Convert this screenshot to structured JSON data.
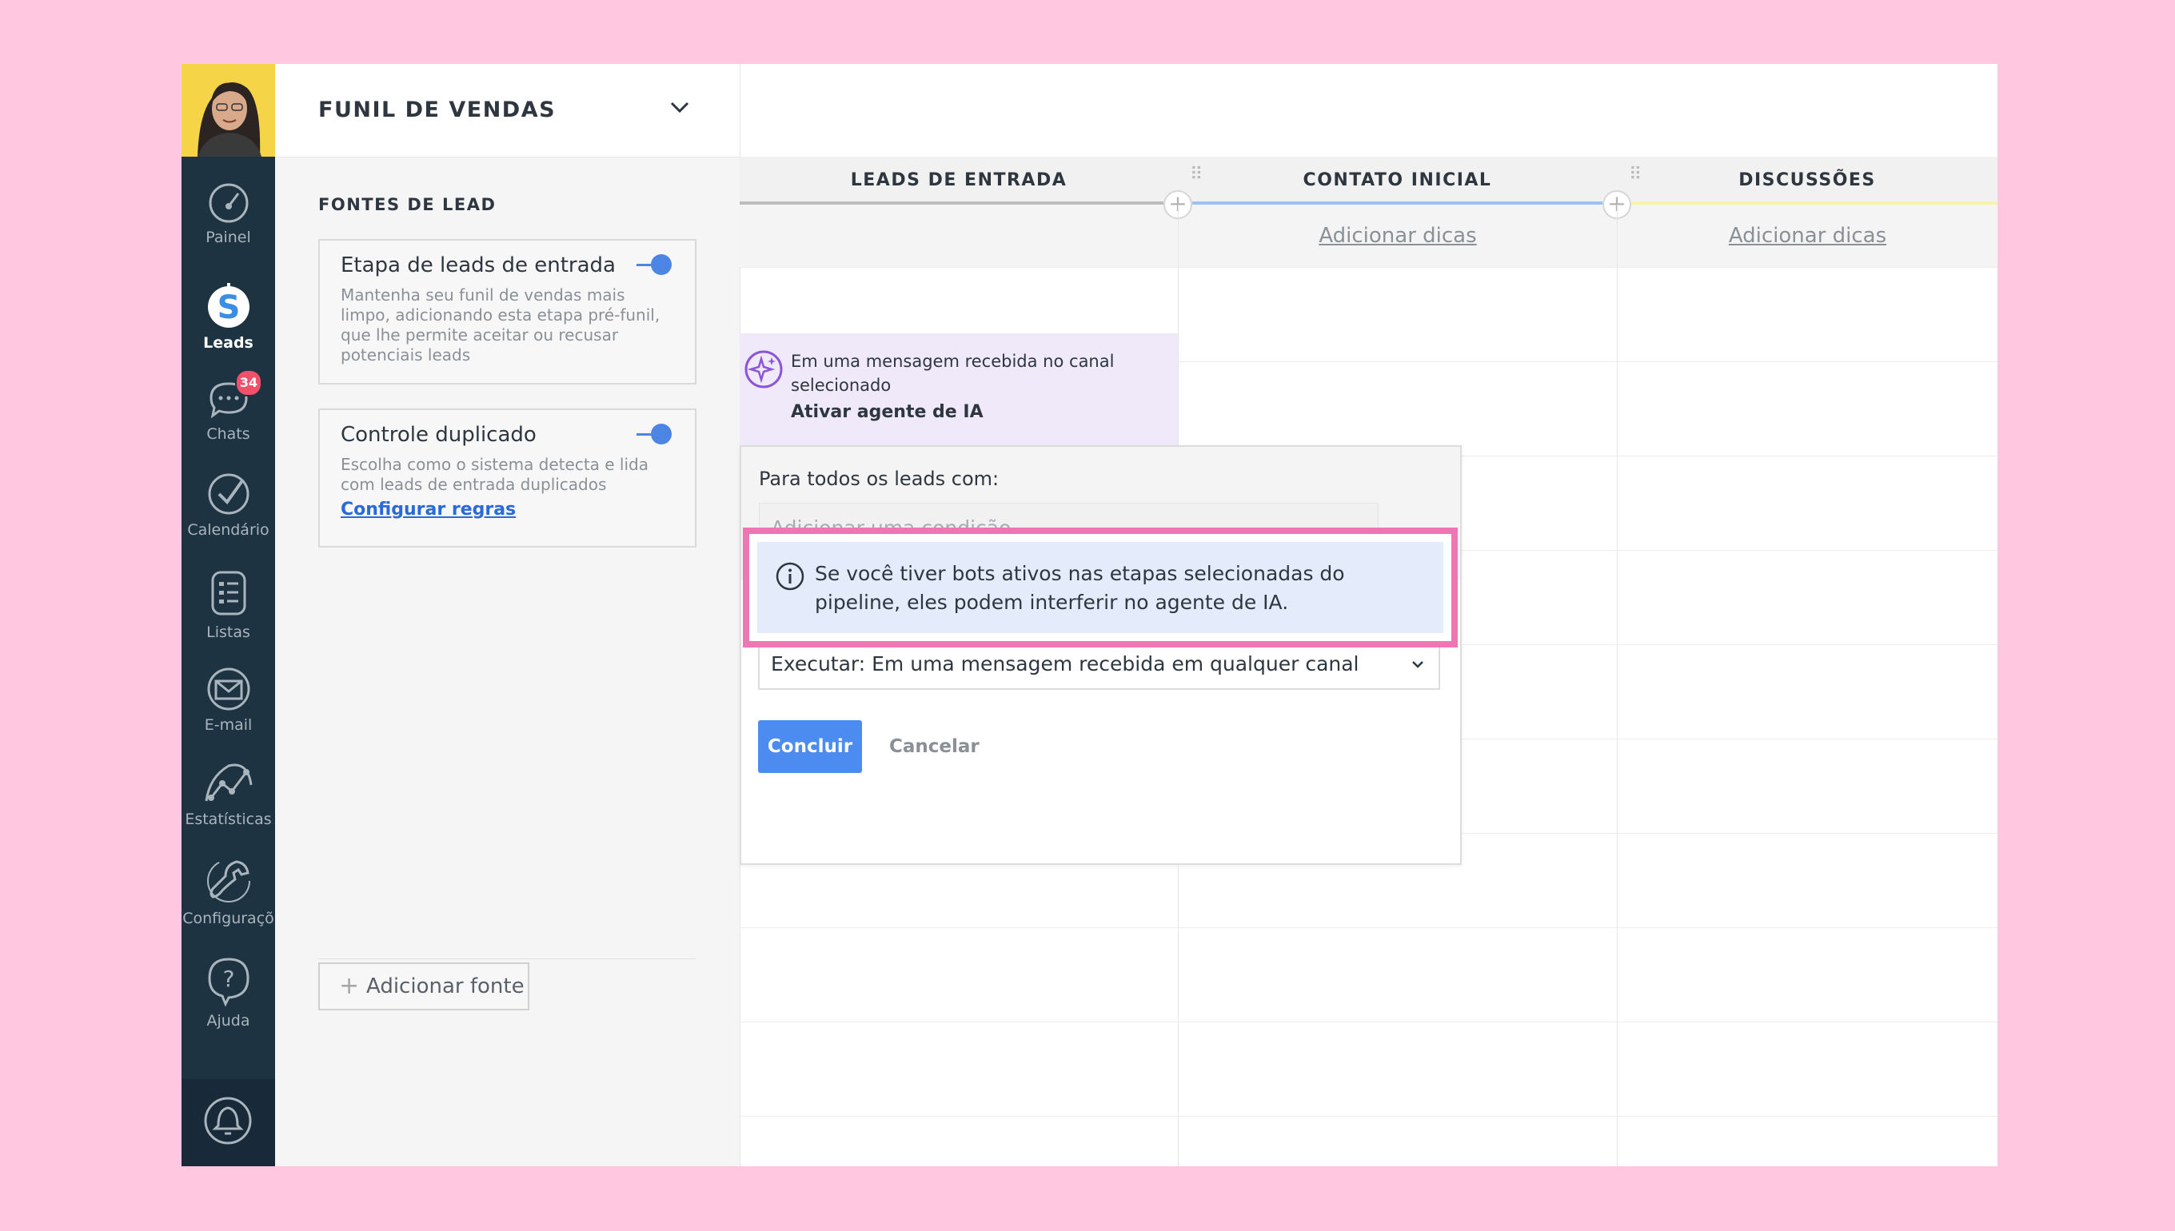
{
  "nav": {
    "items": [
      {
        "label": "Painel",
        "icon": "speedometer-icon"
      },
      {
        "label": "Leads",
        "icon": "leads-icon"
      },
      {
        "label": "Chats",
        "icon": "chat-icon",
        "badge": "34"
      },
      {
        "label": "Calendário",
        "icon": "checkmark-icon"
      },
      {
        "label": "Listas",
        "icon": "list-icon"
      },
      {
        "label": "E-mail",
        "icon": "mail-icon"
      },
      {
        "label": "Estatísticas",
        "icon": "stats-icon"
      },
      {
        "label": "Configuraçõ",
        "icon": "wrench-icon"
      },
      {
        "label": "Ajuda",
        "icon": "help-icon"
      }
    ],
    "bell_icon": "bell-icon"
  },
  "panel": {
    "title": "FUNIL DE VENDAS",
    "section": "FONTES DE LEAD",
    "cards": [
      {
        "title": "Etapa de leads de entrada",
        "description": "Mantenha seu funil de vendas mais limpo, adicionando esta etapa pré-funil, que lhe permite aceitar ou recusar potenciais leads",
        "enabled": true
      },
      {
        "title": "Controle duplicado",
        "description": "Escolha como o sistema detecta e lida com leads de entrada duplicados",
        "link": "Configurar regras",
        "enabled": true
      }
    ],
    "add_source": "Adicionar fonte"
  },
  "pipeline": {
    "columns": [
      {
        "title": "LEADS DE ENTRADA",
        "color": "#bdbdbd",
        "tip": ""
      },
      {
        "title": "CONTATO INICIAL",
        "color": "#9cc2f7",
        "tip": "Adicionar dicas"
      },
      {
        "title": "DISCUSSÕES",
        "color": "#f6f2a8",
        "tip": "Adicionar dicas"
      }
    ]
  },
  "ai_trigger": {
    "text": "Em uma mensagem recebida no canal selecionado",
    "action": "Ativar agente de IA"
  },
  "editor": {
    "label": "Para todos os leads com:",
    "condition_placeholder": "Adicionar uma condição",
    "info": "Se você tiver bots ativos nas etapas selecionadas do pipeline, eles podem interferir no agente de IA.",
    "execute": "Executar: Em uma mensagem recebida em qualquer canal",
    "confirm": "Concluir",
    "cancel": "Cancelar"
  },
  "colors": {
    "nav_bg": "#1e3342",
    "primary": "#4c8bf0",
    "highlight": "#f075b3",
    "background": "#ffc7e0"
  }
}
